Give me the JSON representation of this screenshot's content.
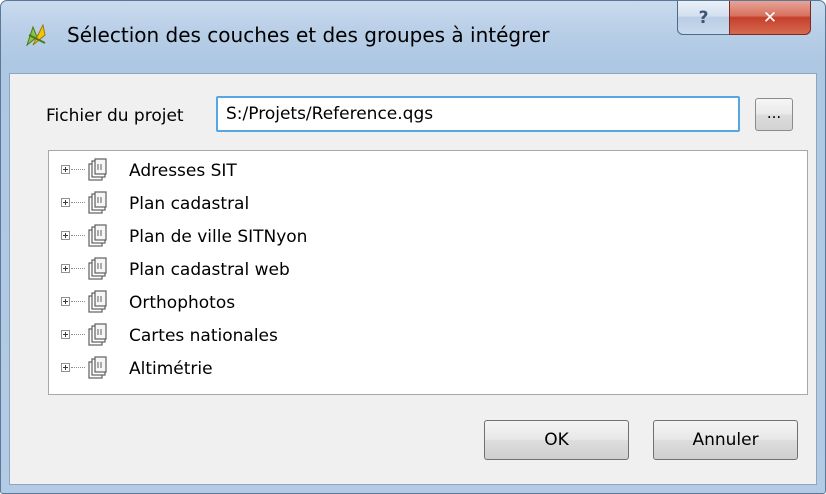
{
  "window": {
    "title": "Sélection des couches et des groupes à intégrer",
    "help_label": "?",
    "close_label": "✕"
  },
  "project": {
    "label": "Fichier du projet",
    "path": "S:/Projets/Reference.qgs",
    "browse_label": "..."
  },
  "tree": {
    "items": [
      {
        "label": "Adresses SIT"
      },
      {
        "label": "Plan cadastral"
      },
      {
        "label": "Plan de ville SITNyon"
      },
      {
        "label": "Plan cadastral web"
      },
      {
        "label": "Orthophotos"
      },
      {
        "label": "Cartes nationales"
      },
      {
        "label": "Altimétrie"
      }
    ],
    "item_icon": "layer-group-icon",
    "expand_icon": "plus-expander-icon"
  },
  "buttons": {
    "ok_label": "OK",
    "cancel_label": "Annuler"
  },
  "colors": {
    "title_bar": "#b9cfe7",
    "close_button": "#c5402b",
    "input_focus_border": "#56a6e4",
    "dialog_background": "#f0f0f0"
  }
}
